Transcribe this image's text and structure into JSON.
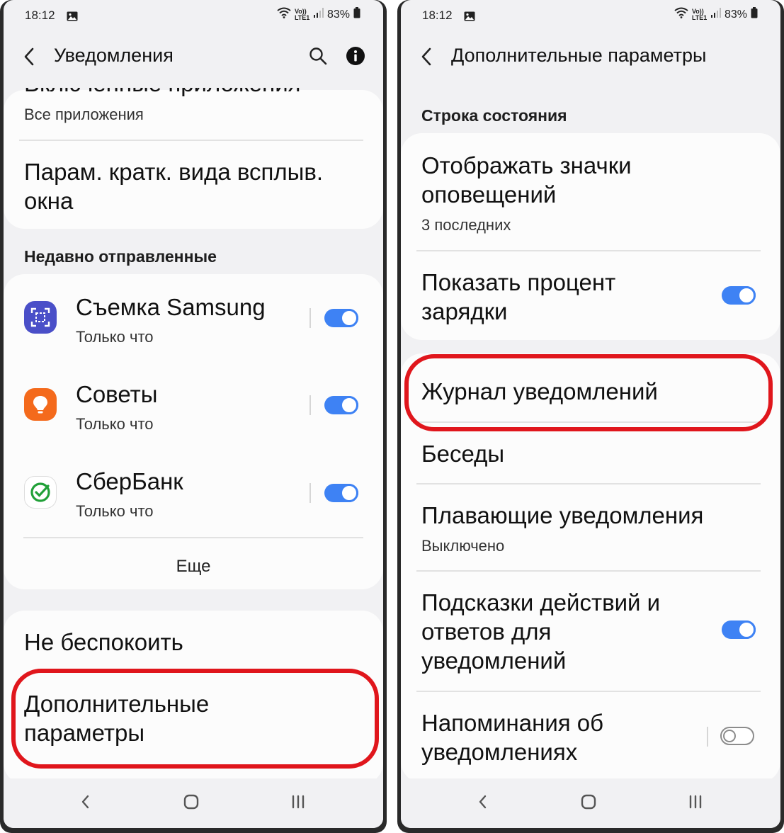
{
  "status_bar": {
    "time": "18:12",
    "network_tag": "Vo)) LTE1",
    "battery": "83%",
    "icons": [
      "gallery-icon",
      "wifi-icon",
      "volte-icon",
      "signal-icon",
      "battery-icon"
    ]
  },
  "left_screen": {
    "header": {
      "title": "Уведомления",
      "icons": [
        "back-icon",
        "search-icon",
        "info-icon"
      ]
    },
    "top_card": {
      "clipped_title": "Включенные приложения",
      "clipped_value": "Все приложения",
      "popup_settings": "Парам. кратк. вида всплыв. окна"
    },
    "recent_section": {
      "title": "Недавно отправленные",
      "apps": [
        {
          "name": "Съемка Samsung",
          "time": "Только что",
          "enabled": true,
          "icon": "samsung-capture-icon",
          "color": "#4a4fc8"
        },
        {
          "name": "Советы",
          "time": "Только что",
          "enabled": true,
          "icon": "tips-bulb-icon",
          "color": "#f46a1c"
        },
        {
          "name": "СберБанк",
          "time": "Только что",
          "enabled": true,
          "icon": "sberbank-icon",
          "color": "#21a038"
        }
      ],
      "more": "Еще"
    },
    "bottom_card": {
      "do_not_disturb": "Не беспокоить",
      "advanced": "Дополнительные параметры"
    }
  },
  "right_screen": {
    "header": {
      "title": "Дополнительные параметры",
      "icons": [
        "back-icon"
      ]
    },
    "status_section": {
      "title": "Строка состояния",
      "show_icons": {
        "title": "Отображать значки оповещений",
        "value": "3 последних"
      },
      "battery_percent": {
        "title": "Показать процент зарядки",
        "enabled": true
      }
    },
    "items": {
      "history": "Журнал уведомлений",
      "conversations": "Беседы",
      "floating": {
        "title": "Плавающие уведомления",
        "value": "Выключено"
      },
      "suggestions": {
        "title": "Подсказки действий и ответов для уведомлений",
        "enabled": true
      },
      "reminders": {
        "title": "Напоминания об уведомлениях",
        "enabled": false
      }
    }
  },
  "nav_bar": {
    "icons": [
      "recents-icon",
      "home-icon",
      "back-nav-icon"
    ]
  },
  "colors": {
    "accent": "#3e82f4",
    "highlight": "#e0161c",
    "background": "#f1f1f3",
    "card": "#fcfcfc"
  }
}
